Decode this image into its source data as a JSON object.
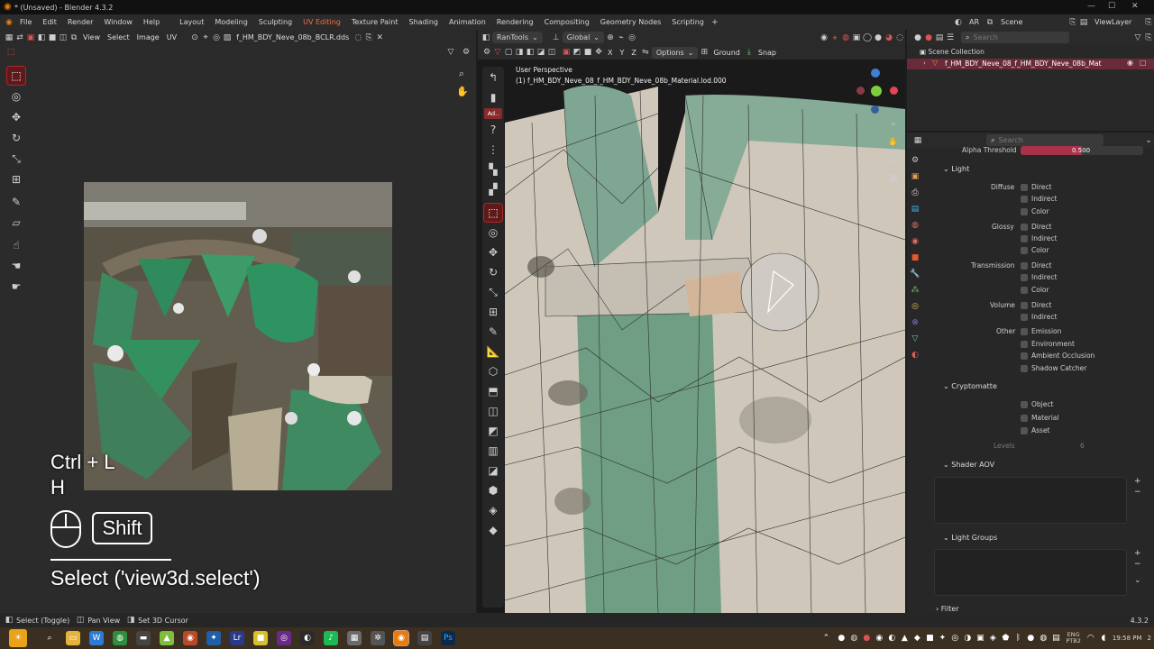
{
  "window": {
    "title": "* (Unsaved) - Blender 4.3.2"
  },
  "menu": [
    "File",
    "Edit",
    "Render",
    "Window",
    "Help"
  ],
  "workspaces": [
    "Layout",
    "Modeling",
    "Sculpting",
    "UV Editing",
    "Texture Paint",
    "Shading",
    "Animation",
    "Rendering",
    "Compositing",
    "Geometry Nodes",
    "Scripting"
  ],
  "active_workspace": "UV Editing",
  "scene": {
    "ar_label": "AR",
    "scene_name": "Scene",
    "view_layer": "ViewLayer"
  },
  "uv_editor": {
    "menus": [
      "View",
      "Select",
      "Image",
      "UV"
    ],
    "image_name": "f_HM_BDY_Neve_08b_BCLR.dds"
  },
  "viewport": {
    "addon": "RanTools",
    "orientation": "Global",
    "axes": [
      "X",
      "Y",
      "Z"
    ],
    "options_label": "Options",
    "ground_label": "Ground",
    "snap_label": "Snap",
    "perspective": "User Perspective",
    "object_info": "(1) f_HM_BDY_Neve_08_f_HM_BDY_Neve_08b_Material.lod.000",
    "add_badge": "Ad.."
  },
  "outliner": {
    "search_placeholder": "Search",
    "collection": "Scene Collection",
    "item": "f_HM_BDY_Neve_08_f_HM_BDY_Neve_08b_Mat"
  },
  "properties": {
    "search_placeholder": "Search",
    "alpha_threshold_label": "Alpha Threshold",
    "alpha_threshold_value": "0.500",
    "light_section": "Light",
    "groups": [
      {
        "label": "Diffuse",
        "items": [
          "Direct",
          "Indirect",
          "Color"
        ]
      },
      {
        "label": "Glossy",
        "items": [
          "Direct",
          "Indirect",
          "Color"
        ]
      },
      {
        "label": "Transmission",
        "items": [
          "Direct",
          "Indirect",
          "Color"
        ]
      },
      {
        "label": "Volume",
        "items": [
          "Direct",
          "Indirect"
        ]
      },
      {
        "label": "Other",
        "items": [
          "Emission",
          "Environment",
          "Ambient Occlusion",
          "Shadow Catcher"
        ]
      }
    ],
    "cryptomatte_section": "Cryptomatte",
    "crypto_items": [
      "Object",
      "Material",
      "Asset"
    ],
    "levels_label": "Levels",
    "levels_value": "6",
    "shader_aov_section": "Shader AOV",
    "light_groups_section": "Light Groups",
    "filter_section": "Filter"
  },
  "overlay": {
    "keys_line1": "Ctrl + L",
    "keys_line2": "H",
    "shift_label": "Shift",
    "operator": "Select ('view3d.select')"
  },
  "statusbar": {
    "items": [
      "Select (Toggle)",
      "Pan View",
      "Set 3D Cursor"
    ],
    "version": "4.3.2"
  },
  "taskbar": {
    "lang_line1": "ENG",
    "lang_line2": "PTB2",
    "time": "19:58 PM",
    "date": "2"
  },
  "colors": {
    "accent": "#ff6a3d",
    "select_red": "#b02525",
    "taskbar": "#3b2f21"
  }
}
